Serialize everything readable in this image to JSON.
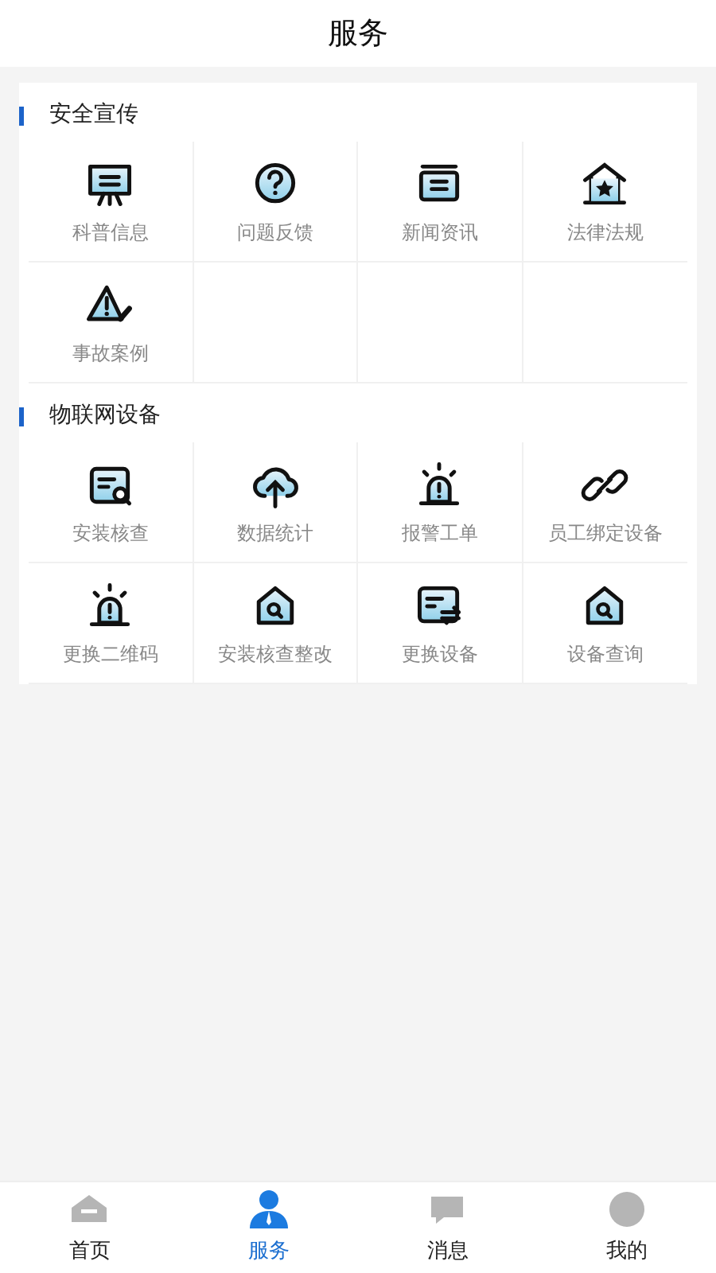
{
  "header": {
    "title": "服务"
  },
  "sections": [
    {
      "title": "安全宣传",
      "items": [
        {
          "label": "科普信息"
        },
        {
          "label": "问题反馈"
        },
        {
          "label": "新闻资讯"
        },
        {
          "label": "法律法规"
        },
        {
          "label": "事故案例"
        }
      ]
    },
    {
      "title": "物联网设备",
      "items": [
        {
          "label": "安装核查"
        },
        {
          "label": "数据统计"
        },
        {
          "label": "报警工单"
        },
        {
          "label": "员工绑定设备"
        },
        {
          "label": "更换二维码"
        },
        {
          "label": "安装核查整改"
        },
        {
          "label": "更换设备"
        },
        {
          "label": "设备查询"
        }
      ]
    }
  ],
  "tabbar": [
    {
      "label": "首页",
      "selected": false
    },
    {
      "label": "服务",
      "selected": true
    },
    {
      "label": "消息",
      "selected": false
    },
    {
      "label": "我的",
      "selected": false
    }
  ]
}
